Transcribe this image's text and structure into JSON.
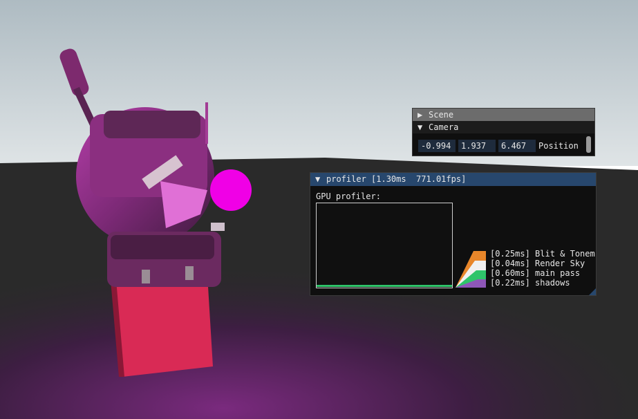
{
  "scene_panel": {
    "scene_header": "Scene",
    "camera_header": "Camera",
    "position": {
      "x": "-0.994",
      "y": "1.937",
      "z": "6.467",
      "label": "Position"
    }
  },
  "profiler": {
    "title": "profiler [1.30ms  771.01fps]",
    "gpu_label": "GPU profiler:",
    "entries": [
      {
        "time": "[0.25ms]",
        "name": "Blit & Tonem",
        "color": "#e8862a"
      },
      {
        "time": "[0.04ms]",
        "name": "Render Sky",
        "color": "#f0f0f0"
      },
      {
        "time": "[0.60ms]",
        "name": "main pass",
        "color": "#2fc46a"
      },
      {
        "time": "[0.22ms]",
        "name": "shadows",
        "color": "#8e57b8"
      }
    ]
  },
  "colors": {
    "header_active": "#27476d",
    "field_bg": "#1e2b3c",
    "sky": "#c4cdd1",
    "ground": "#2b2b2b"
  },
  "icons": {
    "expand": "triangle-right",
    "collapse": "triangle-down"
  }
}
